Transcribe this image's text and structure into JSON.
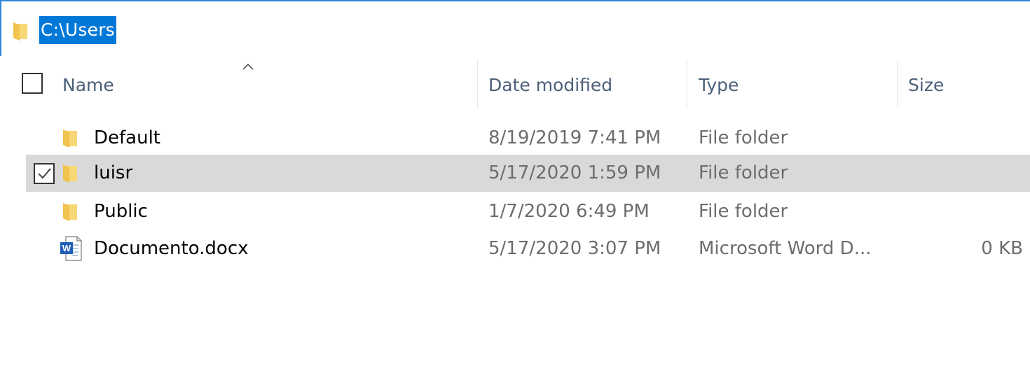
{
  "address_bar": {
    "path": "C:\\Users",
    "icon": "folder-icon"
  },
  "columns": {
    "name": "Name",
    "date_modified": "Date modified",
    "type": "Type",
    "size": "Size",
    "sort_indicator": "chevron-up-icon"
  },
  "rows": [
    {
      "name": "Default",
      "date": "8/19/2019 7:41 PM",
      "type": "File folder",
      "size": "",
      "icon": "folder-icon",
      "selected": false
    },
    {
      "name": "luisr",
      "date": "5/17/2020 1:59 PM",
      "type": "File folder",
      "size": "",
      "icon": "folder-icon",
      "selected": true
    },
    {
      "name": "Public",
      "date": "1/7/2020 6:49 PM",
      "type": "File folder",
      "size": "",
      "icon": "folder-icon",
      "selected": false
    },
    {
      "name": "Documento.docx",
      "date": "5/17/2020 3:07 PM",
      "type": "Microsoft Word D...",
      "size": "0 KB",
      "icon": "word-document-icon",
      "selected": false
    }
  ],
  "colors": {
    "accent": "#0078d7",
    "selection": "#d9d9d9",
    "header_text": "#4c607a",
    "secondary_text": "#6d6d6d",
    "folder_yellow": "#f8d775"
  }
}
